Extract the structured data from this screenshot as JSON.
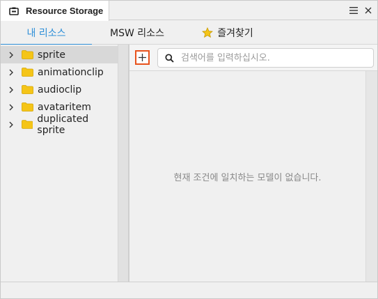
{
  "window": {
    "title": "Resource Storage",
    "icons": {
      "title": "storage-box-icon",
      "menu": "hamburger-menu-icon",
      "close": "close-icon"
    }
  },
  "tabs": [
    {
      "label": "내 리소스",
      "active": true
    },
    {
      "label": "MSW 리소스",
      "active": false
    },
    {
      "label": "즐겨찾기",
      "active": false,
      "icon": "star-icon"
    }
  ],
  "tree": {
    "items": [
      {
        "label": "sprite",
        "selected": true
      },
      {
        "label": "animationclip",
        "selected": false
      },
      {
        "label": "audioclip",
        "selected": false
      },
      {
        "label": "avataritem",
        "selected": false
      },
      {
        "label": "duplicated sprite",
        "selected": false
      }
    ]
  },
  "toolbar": {
    "add_icon": "plus-icon",
    "search_placeholder": "검색어를 입력하십시오.",
    "search_value": ""
  },
  "main": {
    "empty_message": "현재 조건에 일치하는 모델이 없습니다."
  },
  "colors": {
    "accent": "#2e8fd8",
    "add_button_border": "#e8521c",
    "folder": "#f5c518",
    "star": "#f5c518"
  }
}
